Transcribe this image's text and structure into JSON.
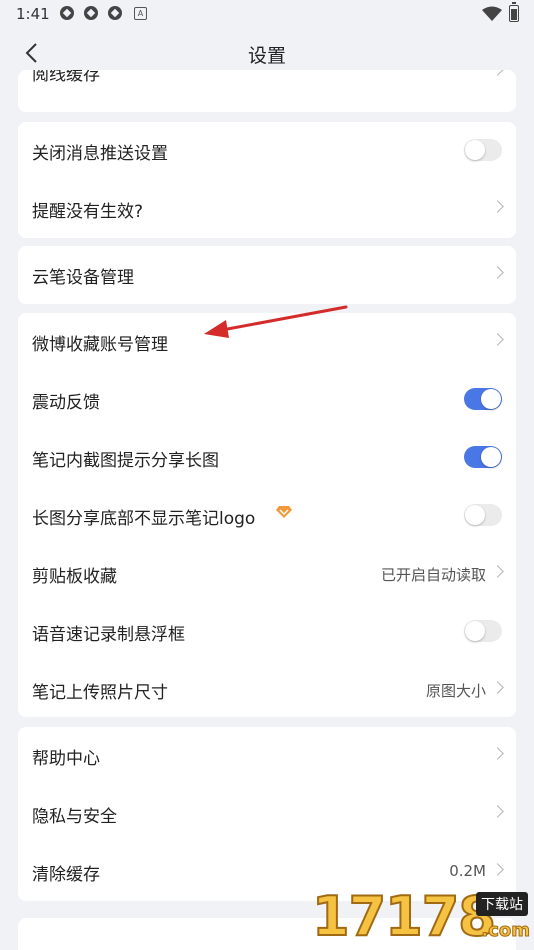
{
  "status_bar": {
    "time": "1:41",
    "notification_icons": [
      "app-icon",
      "app-icon",
      "app-icon",
      "a-icon"
    ],
    "system_icons": [
      "wifi-icon",
      "battery-icon"
    ]
  },
  "header": {
    "title": "设置",
    "back_icon": "chevron-left-icon"
  },
  "sections": {
    "top_partial": {
      "label": "阅线缓存"
    },
    "push": [
      {
        "label": "关闭消息推送设置",
        "control": "toggle",
        "on": false
      },
      {
        "label": "提醒没有生效?",
        "control": "chevron"
      }
    ],
    "device": [
      {
        "label": "云笔设备管理",
        "control": "chevron"
      }
    ],
    "features": [
      {
        "label": "微博收藏账号管理",
        "control": "chevron"
      },
      {
        "label": "震动反馈",
        "control": "toggle",
        "on": true
      },
      {
        "label": "笔记内截图提示分享长图",
        "control": "toggle",
        "on": true
      },
      {
        "label": "长图分享底部不显示笔记logo",
        "control": "toggle",
        "on": false,
        "badge_icon": "vip-diamond-icon"
      },
      {
        "label": "剪贴板收藏",
        "value": "已开启自动读取",
        "control": "chevron"
      },
      {
        "label": "语音速记录制悬浮框",
        "control": "toggle",
        "on": false
      },
      {
        "label": "笔记上传照片尺寸",
        "value": "原图大小",
        "control": "chevron"
      }
    ],
    "help": [
      {
        "label": "帮助中心",
        "control": "chevron"
      },
      {
        "label": "隐私与安全",
        "control": "chevron"
      },
      {
        "label": "清除缓存",
        "value": "0.2M",
        "control": "chevron"
      }
    ]
  },
  "watermark": {
    "number": "17178",
    "tag": "下载站",
    "suffix": ".com"
  },
  "colors": {
    "accent": "#4a77e6",
    "background": "#f1f2f6",
    "card": "#ffffff",
    "annotation_arrow": "#d42b2b",
    "vip_badge": "#f29a3a"
  }
}
